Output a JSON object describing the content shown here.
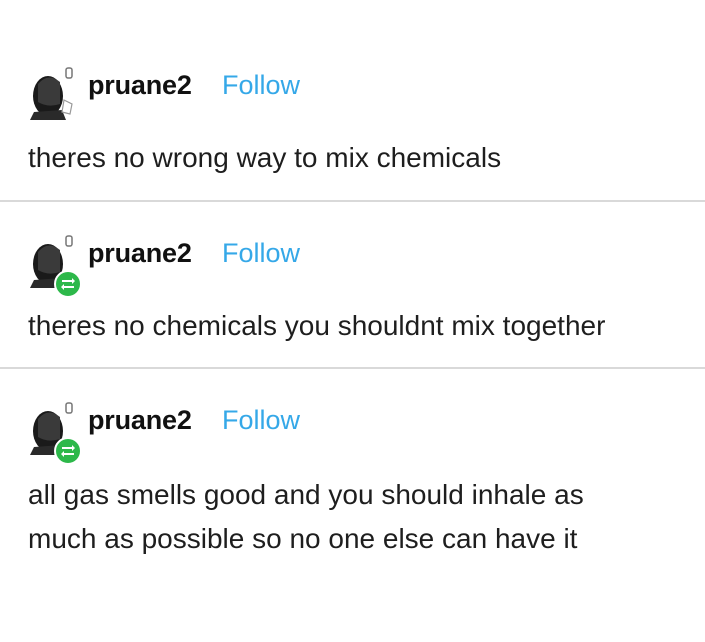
{
  "posts": [
    {
      "username": "pruane2",
      "follow_label": "Follow",
      "text": "theres no wrong way to mix chemicals",
      "reblogged": false
    },
    {
      "username": "pruane2",
      "follow_label": "Follow",
      "text": "theres no chemicals you shouldnt mix together",
      "reblogged": true
    },
    {
      "username": "pruane2",
      "follow_label": "Follow",
      "text": "all gas smells good and you should inhale as\nmuch as possible so no one else can have it",
      "reblogged": true
    }
  ],
  "colors": {
    "follow": "#35a8e8",
    "reblog_badge": "#2db84a",
    "divider": "#d9d9d9"
  }
}
